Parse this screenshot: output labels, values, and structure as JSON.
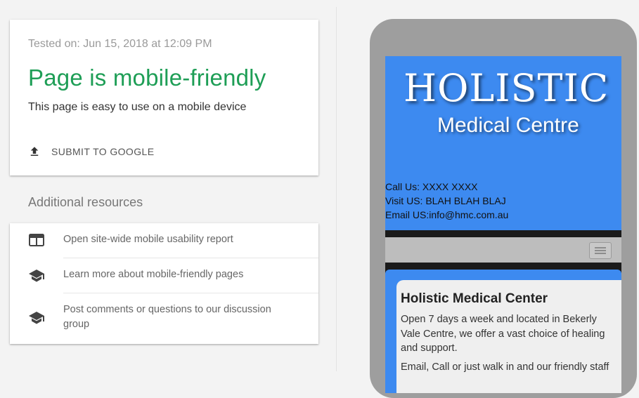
{
  "result": {
    "tested_on": "Tested on: Jun 15, 2018 at 12:09 PM",
    "verdict": "Page is mobile-friendly",
    "description": "This page is easy to use on a mobile device",
    "submit_label": "SUBMIT TO GOOGLE",
    "verdict_color": "#1e9e56"
  },
  "resources": {
    "title": "Additional resources",
    "items": [
      {
        "icon": "web-window-icon",
        "label": "Open site-wide mobile usability report"
      },
      {
        "icon": "school-icon",
        "label": "Learn more about mobile-friendly pages"
      },
      {
        "icon": "school-icon",
        "label": "Post comments or questions to our discussion group"
      }
    ]
  },
  "preview": {
    "logo_title": "HOLISTIC",
    "logo_subtitle": "Medical Centre",
    "contact": [
      "Call Us: XXXX XXXX",
      "Visit US: BLAH BLAH BLAJ",
      "Email US:info@hmc.com.au"
    ],
    "menu_icon": "hamburger-menu-icon",
    "card_title": "Holistic Medical Center",
    "card_body_1": "Open 7 days a week and located in Bekerly Vale Centre, we offer a vast choice of healing and support.",
    "card_body_2": "Email, Call or just walk in and our friendly staff",
    "header_color": "#3d8af0"
  }
}
